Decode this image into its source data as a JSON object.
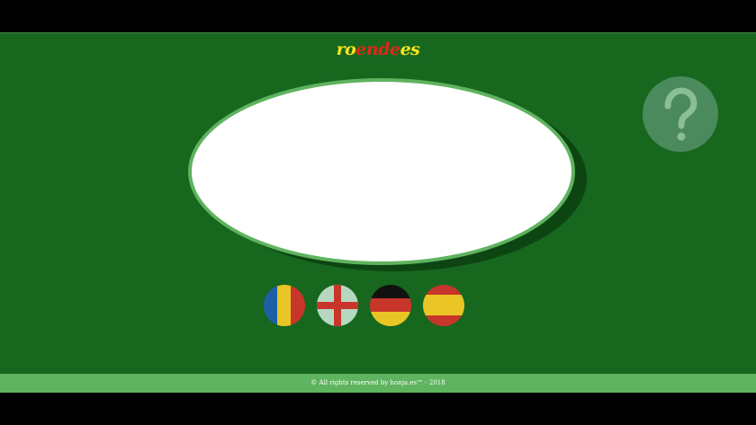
{
  "logo": {
    "part1": "ro",
    "part2": "ende",
    "part3": "es"
  },
  "help": {
    "icon": "question-mark-icon"
  },
  "flags": [
    {
      "lang": "ro",
      "icon": "romania-flag-icon"
    },
    {
      "lang": "en",
      "icon": "england-flag-icon"
    },
    {
      "lang": "de",
      "icon": "germany-flag-icon"
    },
    {
      "lang": "es",
      "icon": "spain-flag-icon"
    }
  ],
  "footer": {
    "text": "© All rights reserved by honja.es™ - 2018"
  },
  "colors": {
    "background": "#17671f",
    "accent": "#5fb45f",
    "logo_yellow": "#f7e51c",
    "logo_red": "#e2261a"
  }
}
